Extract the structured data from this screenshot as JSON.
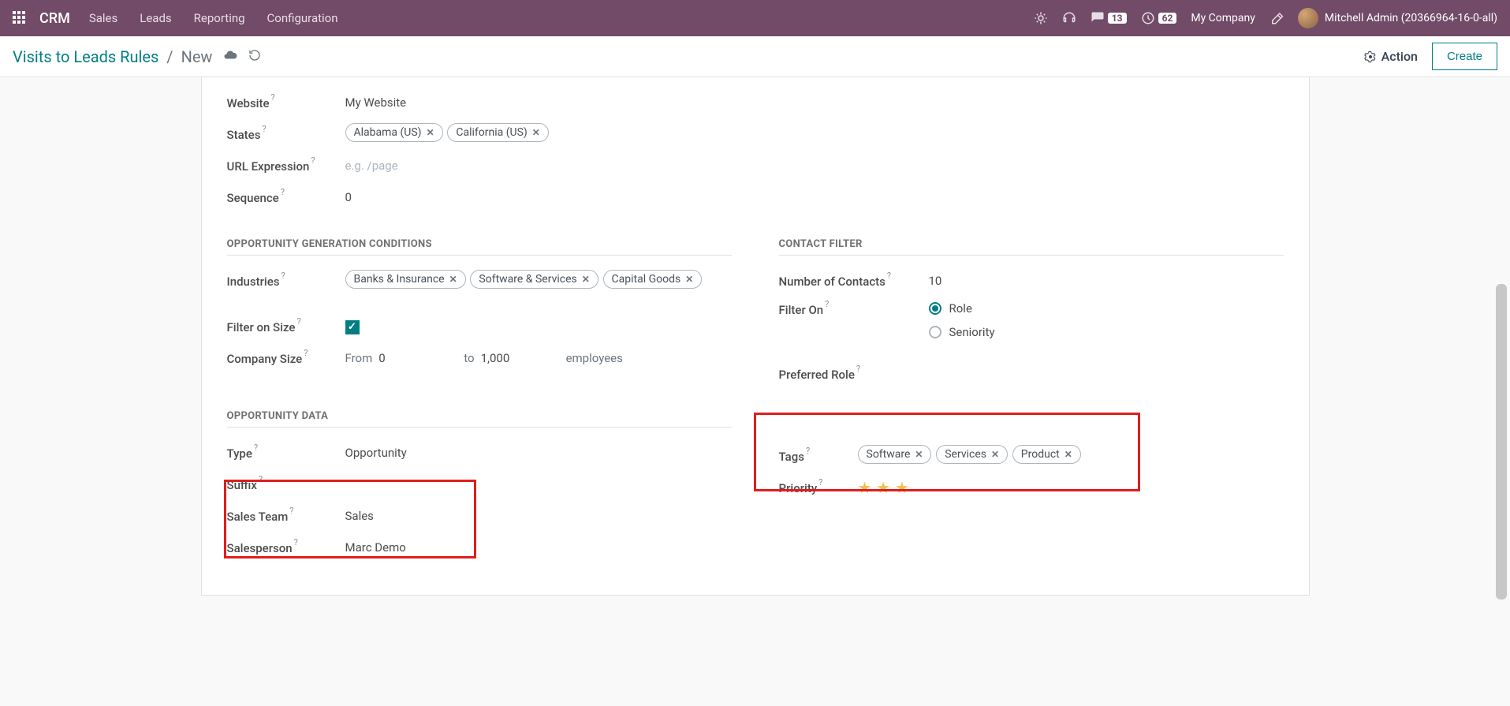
{
  "nav": {
    "brand": "CRM",
    "items": [
      "Sales",
      "Leads",
      "Reporting",
      "Configuration"
    ],
    "messages_count": "13",
    "activities_count": "62",
    "company": "My Company",
    "user": "Mitchell Admin (20366964-16-0-all)"
  },
  "breadcrumb": {
    "parent": "Visits to Leads Rules",
    "current": "New",
    "action_label": "Action",
    "create_label": "Create"
  },
  "form": {
    "website_label": "Website",
    "website_value": "My Website",
    "states_label": "States",
    "states": [
      "Alabama (US)",
      "California (US)"
    ],
    "url_label": "URL Expression",
    "url_placeholder": "e.g. /page",
    "sequence_label": "Sequence",
    "sequence_value": "0",
    "section_conditions": "Opportunity Generation Conditions",
    "industries_label": "Industries",
    "industries": [
      "Banks & Insurance",
      "Software & Services",
      "Capital Goods"
    ],
    "filter_size_label": "Filter on Size",
    "company_size_label": "Company Size",
    "from_label": "From",
    "from_value": "0",
    "to_label": "to",
    "to_value": "1,000",
    "employees_label": "employees",
    "section_contact": "Contact Filter",
    "contacts_label": "Number of Contacts",
    "contacts_value": "10",
    "filter_on_label": "Filter On",
    "filter_role": "Role",
    "filter_seniority": "Seniority",
    "preferred_role_label": "Preferred Role",
    "section_data": "Opportunity Data",
    "type_label": "Type",
    "type_value": "Opportunity",
    "suffix_label": "Suffix",
    "team_label": "Sales Team",
    "team_value": "Sales",
    "salesperson_label": "Salesperson",
    "salesperson_value": "Marc Demo",
    "tags_label": "Tags",
    "tags": [
      "Software",
      "Services",
      "Product"
    ],
    "priority_label": "Priority"
  }
}
